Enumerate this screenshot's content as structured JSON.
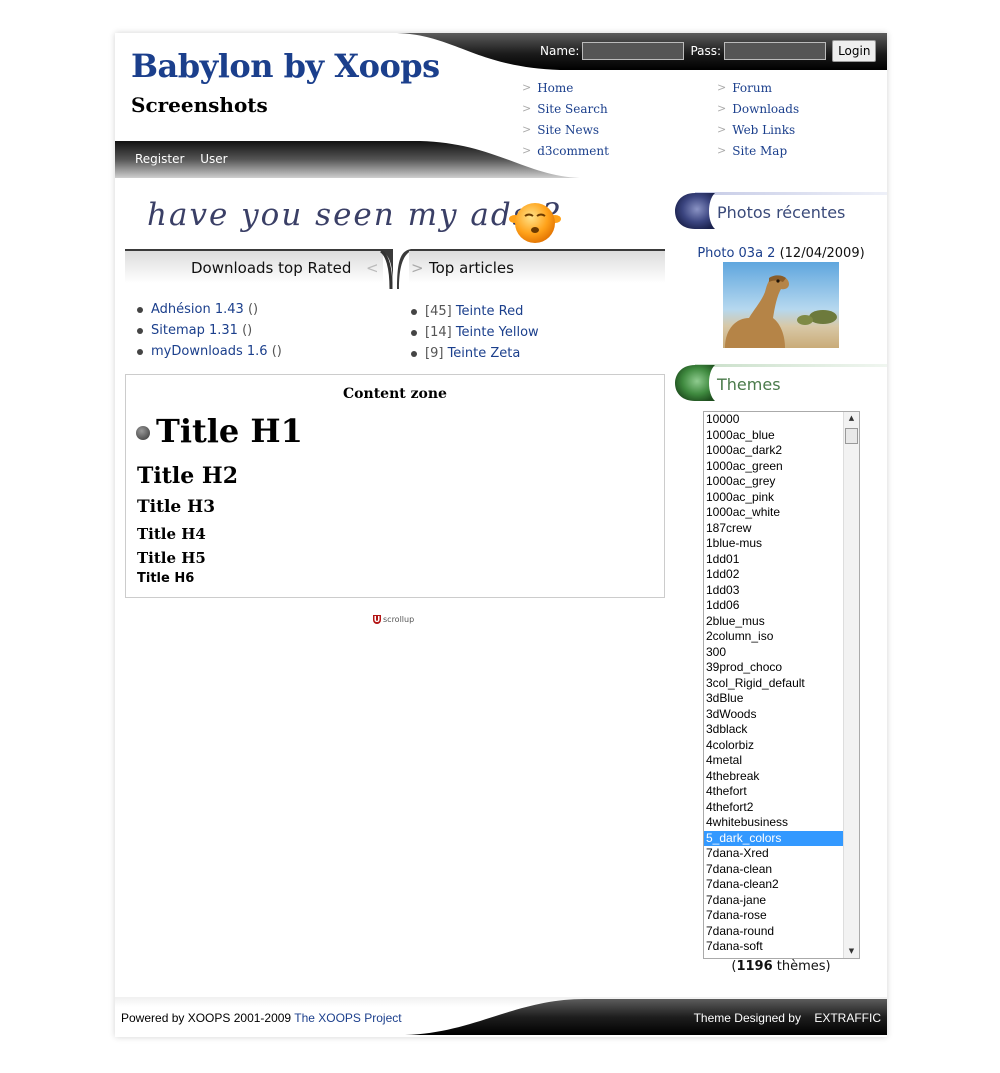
{
  "header": {
    "site_name": "Babylon by Xoops",
    "slogan": "Screenshots",
    "login": {
      "name_label": "Name:",
      "pass_label": "Pass:",
      "login_button": "Login"
    },
    "nav_left": [
      "Home",
      "Site Search",
      "Site News",
      "d3comment"
    ],
    "nav_right": [
      "Forum",
      "Downloads",
      "Web Links",
      "Site Map"
    ],
    "user_menu": [
      "Register",
      "User"
    ]
  },
  "ads": {
    "text": "have you seen my ads ?"
  },
  "blocks": {
    "downloads": {
      "title": "Downloads top Rated",
      "items": [
        {
          "label": "Adhésion 1.43",
          "suffix": "()"
        },
        {
          "label": "Sitemap 1.31",
          "suffix": "()"
        },
        {
          "label": "myDownloads 1.6",
          "suffix": "()"
        }
      ]
    },
    "articles": {
      "title": "Top articles",
      "items": [
        {
          "count": "[45]",
          "label": "Teinte Red"
        },
        {
          "count": "[14]",
          "label": "Teinte Yellow"
        },
        {
          "count": "[9]",
          "label": "Teinte Zeta"
        }
      ]
    }
  },
  "content": {
    "zone_title": "Content zone",
    "h1": "Title H1",
    "h2": "Title H2",
    "h3": "Title H3",
    "h4": "Title H4",
    "h5": "Title H5",
    "h6": "Title H6",
    "scrollup": "scrollup"
  },
  "sidebar": {
    "photos": {
      "title": "Photos récentes",
      "photo_link": "Photo 03a 2",
      "photo_date": "(12/04/2009)"
    },
    "themes": {
      "title": "Themes",
      "items": [
        "10000",
        "1000ac_blue",
        "1000ac_dark2",
        "1000ac_green",
        "1000ac_grey",
        "1000ac_pink",
        "1000ac_white",
        "187crew",
        "1blue-mus",
        "1dd01",
        "1dd02",
        "1dd03",
        "1dd06",
        "2blue_mus",
        "2column_iso",
        "300",
        "39prod_choco",
        "3col_Rigid_default",
        "3dBlue",
        "3dWoods",
        "3dblack",
        "4colorbiz",
        "4metal",
        "4thebreak",
        "4thefort",
        "4thefort2",
        "4whitebusiness",
        "5_dark_colors",
        "7dana-Xred",
        "7dana-clean",
        "7dana-clean2",
        "7dana-jane",
        "7dana-rose",
        "7dana-round",
        "7dana-soft"
      ],
      "selected": "5_dark_colors",
      "count_open": "(",
      "count_value": "1196",
      "count_label": "thèmes)"
    }
  },
  "footer": {
    "powered": "Powered by XOOPS 2001-2009",
    "project_link": "The XOOPS Project",
    "designed": "Theme Designed by",
    "designer": "EXTRAFFIC"
  },
  "colors": {
    "link": "#1b3f8c",
    "title": "#1b3f8c",
    "selected": "#3399ff",
    "photos_title": "#3a4a7a",
    "themes_title": "#4a7a4a"
  },
  "icons": {
    "nav_arrow": "chevron-right-icon",
    "smiley": "smiley-icon",
    "h1_bullet": "bullet-icon",
    "scrollup": "scrollup-logo"
  }
}
